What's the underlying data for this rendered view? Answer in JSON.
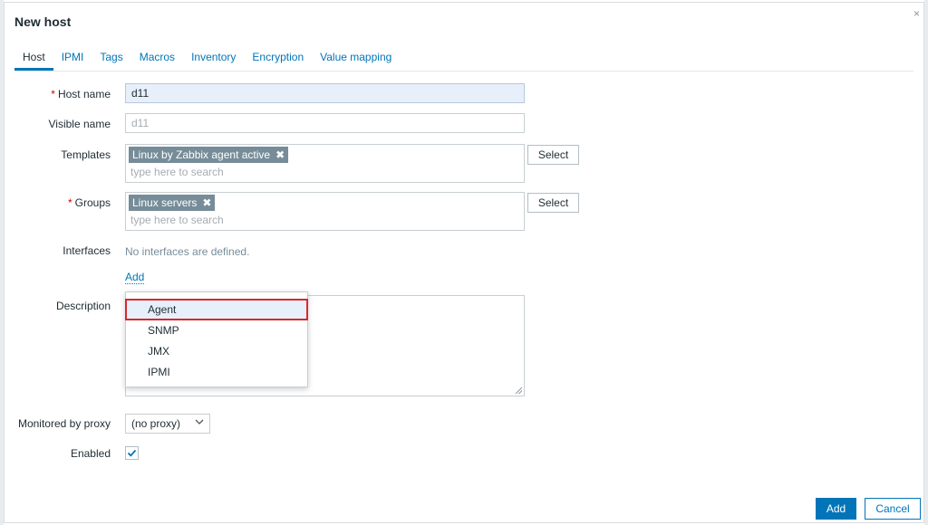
{
  "dialog": {
    "title": "New host",
    "close_glyph": "×"
  },
  "tabs": [
    {
      "label": "Host",
      "active": true
    },
    {
      "label": "IPMI"
    },
    {
      "label": "Tags"
    },
    {
      "label": "Macros"
    },
    {
      "label": "Inventory"
    },
    {
      "label": "Encryption"
    },
    {
      "label": "Value mapping"
    }
  ],
  "form": {
    "host_name": {
      "label": "Host name",
      "required_mark": "*",
      "value": "d11"
    },
    "visible_name": {
      "label": "Visible name",
      "placeholder": "d11"
    },
    "templates": {
      "label": "Templates",
      "chips": [
        "Linux by Zabbix agent active"
      ],
      "placeholder": "type here to search",
      "select_label": "Select"
    },
    "groups": {
      "label": "Groups",
      "required_mark": "*",
      "chips": [
        "Linux servers"
      ],
      "placeholder": "type here to search",
      "select_label": "Select"
    },
    "interfaces": {
      "label": "Interfaces",
      "empty_text": "No interfaces are defined.",
      "add_label": "Add"
    },
    "description": {
      "label": "Description"
    },
    "proxy": {
      "label": "Monitored by proxy",
      "value": "(no proxy)"
    },
    "enabled": {
      "label": "Enabled",
      "checked": true
    }
  },
  "interface_menu": {
    "items": [
      "Agent",
      "SNMP",
      "JMX",
      "IPMI"
    ],
    "highlighted": "Agent"
  },
  "footer": {
    "add_label": "Add",
    "cancel_label": "Cancel"
  },
  "colors": {
    "accent": "#0275b8",
    "required": "#d40000",
    "chip_bg": "#768d99",
    "highlight_outline": "#d7282f"
  },
  "icons": {
    "chip_remove": "close-icon",
    "select_chevron": "chevron-down-icon",
    "checkbox_mark": "checkmark-icon"
  }
}
